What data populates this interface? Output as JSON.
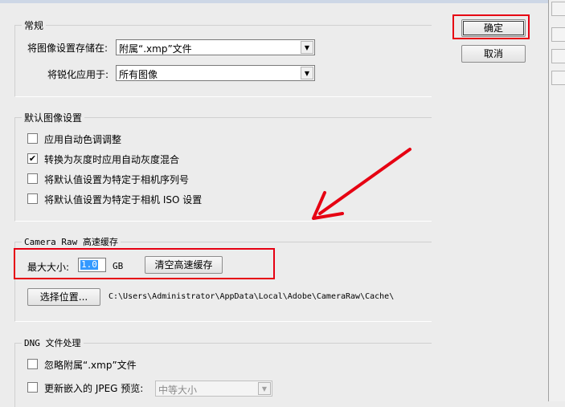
{
  "general": {
    "title": "常规",
    "save_label": "将图像设置存储在:",
    "save_value": "附属“.xmp”文件",
    "sharpen_label": "将锐化应用于:",
    "sharpen_value": "所有图像"
  },
  "buttons": {
    "ok": "确定",
    "cancel": "取消"
  },
  "defaults": {
    "title": "默认图像设置",
    "items": [
      {
        "label": "应用自动色调调整",
        "checked": false
      },
      {
        "label": "转换为灰度时应用自动灰度混合",
        "checked": true
      },
      {
        "label": "将默认值设置为特定于相机序列号",
        "checked": false
      },
      {
        "label": "将默认值设置为特定于相机 ISO 设置",
        "checked": false
      }
    ]
  },
  "cache": {
    "title": "Camera Raw 高速缓存",
    "max_label": "最大大小:",
    "max_value": "1.0",
    "unit": "GB",
    "purge_button": "清空高速缓存",
    "select_button": "选择位置...",
    "path": "C:\\Users\\Administrator\\AppData\\Local\\Adobe\\CameraRaw\\Cache\\"
  },
  "dng": {
    "title": "DNG 文件处理",
    "ignore_label": "忽略附属“.xmp”文件",
    "ignore_checked": false,
    "update_label": "更新嵌入的 JPEG 预览:",
    "update_checked": false,
    "preview_value": "中等大小"
  },
  "colors": {
    "annotation_red": "#e60012"
  }
}
